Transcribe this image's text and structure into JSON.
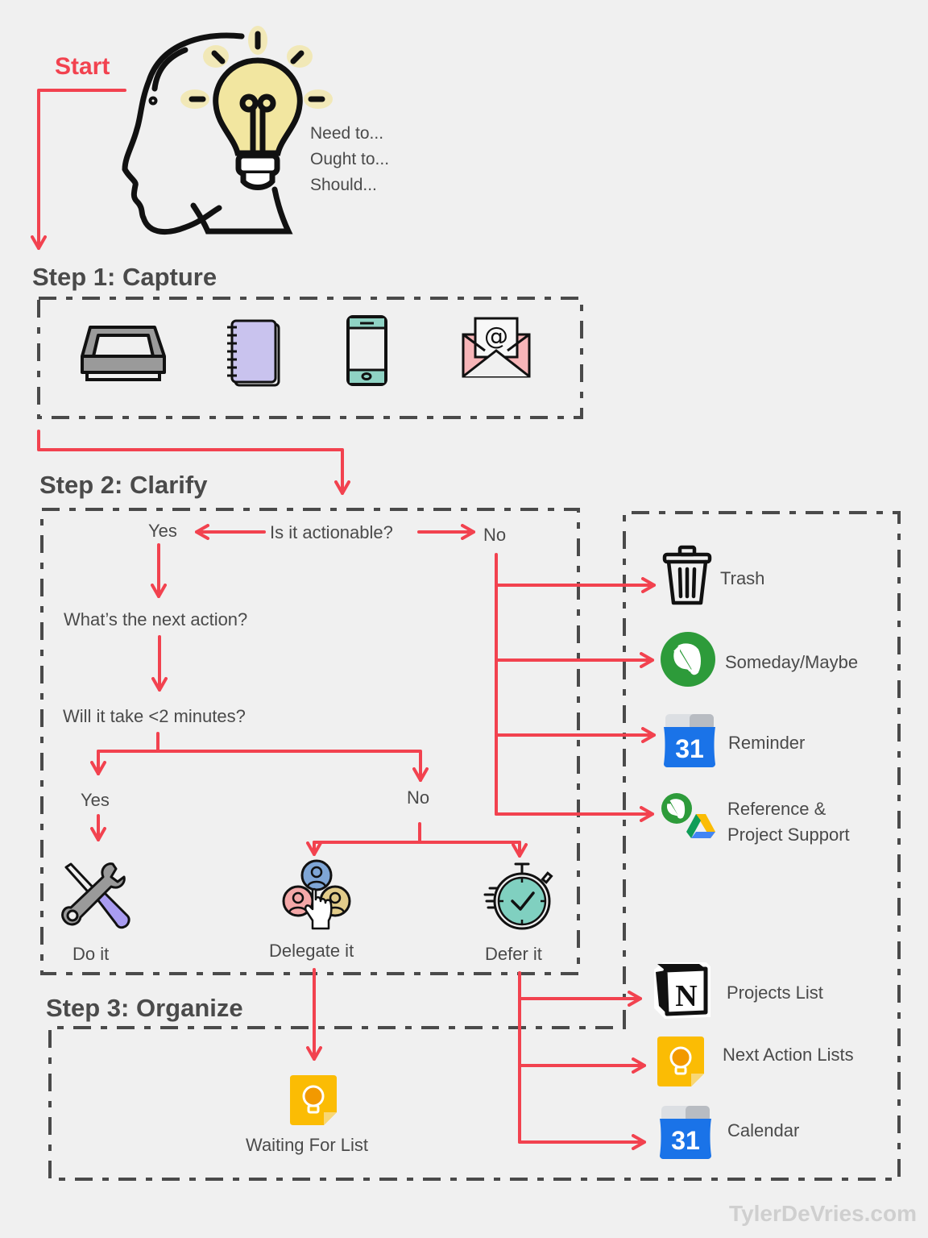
{
  "start_label": "Start",
  "thought_lines": [
    "Need to...",
    "Ought to...",
    "Should..."
  ],
  "steps": {
    "capture": {
      "title": "Step 1: Capture",
      "tools": [
        "inbox-tray-icon",
        "notebook-icon",
        "smartphone-icon",
        "email-icon"
      ]
    },
    "clarify": {
      "title": "Step 2: Clarify",
      "question1": "Is it actionable?",
      "q1_yes": "Yes",
      "q1_no": "No",
      "question2": "What’s the next action?",
      "question3": "Will it take <2 minutes?",
      "q3_yes": "Yes",
      "q3_no": "No",
      "outcomes": [
        "Do it",
        "Delegate it",
        "Defer it"
      ]
    },
    "organize": {
      "title": "Step 3: Organize",
      "waiting_for": "Waiting For List"
    }
  },
  "non_actionable": [
    {
      "label": "Trash",
      "icon": "trash-icon"
    },
    {
      "label": "Someday/Maybe",
      "icon": "evernote-icon"
    },
    {
      "label": "Reminder",
      "icon": "google-calendar-icon"
    },
    {
      "label": "Reference &\nProject Support",
      "line1": "Reference &",
      "line2": "Project Support",
      "icon": "evernote-google-drive-icon"
    }
  ],
  "deferred": [
    {
      "label": "Projects List",
      "icon": "notion-icon"
    },
    {
      "label": "Next Action Lists",
      "icon": "google-keep-icon"
    },
    {
      "label": "Calendar",
      "icon": "google-calendar-icon"
    }
  ],
  "calendar_day": "31",
  "watermark": "TylerDeVries.com",
  "colors": {
    "arrow": "#f2424f",
    "text": "#4a4a4a",
    "dash": "#4a4a4a",
    "background": "#f0f0f0"
  }
}
